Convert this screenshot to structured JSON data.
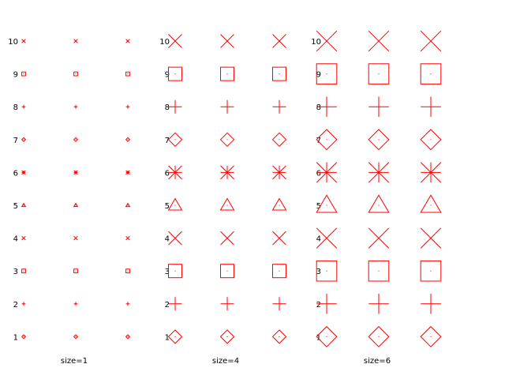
{
  "chart_data": {
    "type": "scatter",
    "title": "",
    "xlabel": "",
    "ylabel": "",
    "marker_color": "#ff0000",
    "row_labels": [
      "10",
      "9",
      "8",
      "7",
      "6",
      "5",
      "4",
      "3",
      "2",
      "1"
    ],
    "row_symbols": {
      "10": "x-cross",
      "9": "dotted-square",
      "8": "plus",
      "7": "dotted-diamond",
      "6": "asterisk",
      "5": "dotted-triangle",
      "4": "x-cross",
      "3": "dotted-square",
      "2": "plus",
      "1": "dotted-diamond"
    },
    "columns_per_group": 3,
    "groups": [
      {
        "label": "size=1",
        "size": 1
      },
      {
        "label": "size=4",
        "size": 4
      },
      {
        "label": "size=6",
        "size": 6
      }
    ]
  }
}
